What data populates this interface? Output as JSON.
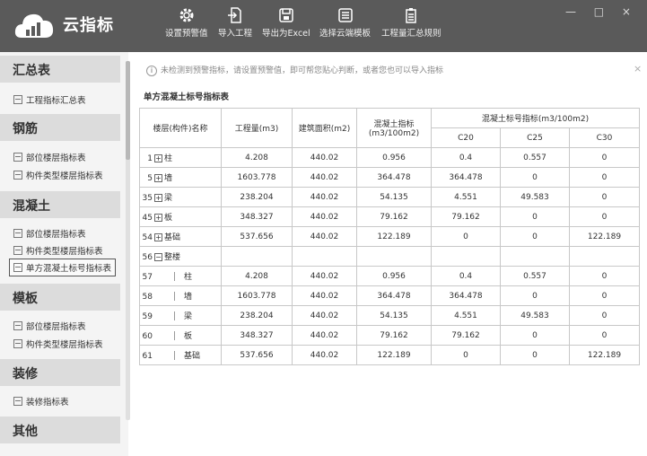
{
  "app": {
    "title": "云指标"
  },
  "window": {
    "controls": "— □ ×"
  },
  "toolbar": [
    {
      "label": "设置预警值",
      "icon": "gear-icon"
    },
    {
      "label": "导入工程",
      "icon": "import-icon"
    },
    {
      "label": "导出为Excel",
      "icon": "export-excel-icon"
    },
    {
      "label": "选择云端模板",
      "icon": "template-icon"
    },
    {
      "label": "工程量汇总规则",
      "icon": "rules-icon"
    }
  ],
  "sidebar": {
    "sections": [
      {
        "title": "汇总表",
        "items": [
          "工程指标汇总表"
        ]
      },
      {
        "title": "钢筋",
        "items": [
          "部位楼层指标表",
          "构件类型楼层指标表"
        ]
      },
      {
        "title": "混凝土",
        "items": [
          "部位楼层指标表",
          "构件类型楼层指标表",
          "单方混凝土标号指标表"
        ]
      },
      {
        "title": "模板",
        "items": [
          "部位楼层指标表",
          "构件类型楼层指标表"
        ]
      },
      {
        "title": "装修",
        "items": [
          "装修指标表"
        ]
      },
      {
        "title": "其他",
        "items": []
      }
    ],
    "active_item": "单方混凝土标号指标表"
  },
  "notice": {
    "text": "未检测到预警指标，请设置预警值，即可帮您贴心判断，或者您也可以导入指标"
  },
  "table": {
    "title": "单方混凝土标号指标表",
    "headers": {
      "name": "楼层(构件)名称",
      "quantity": "工程量(m3)",
      "area": "建筑面积(m2)",
      "concrete_index": "混凝土指标\n(m3/100m2)",
      "grade_group": "混凝土标号指标(m3/100m2)",
      "c20": "C20",
      "c25": "C25",
      "c30": "C30"
    },
    "rows": [
      {
        "num": "1",
        "toggle": "+",
        "name": "柱",
        "qty": "4.208",
        "area": "440.02",
        "index": "0.956",
        "c20": "0.4",
        "c25": "0.557",
        "c30": "0"
      },
      {
        "num": "5",
        "toggle": "+",
        "name": "墙",
        "qty": "1603.778",
        "area": "440.02",
        "index": "364.478",
        "c20": "364.478",
        "c25": "0",
        "c30": "0"
      },
      {
        "num": "35",
        "toggle": "+",
        "name": "梁",
        "qty": "238.204",
        "area": "440.02",
        "index": "54.135",
        "c20": "4.551",
        "c25": "49.583",
        "c30": "0"
      },
      {
        "num": "45",
        "toggle": "+",
        "name": "板",
        "qty": "348.327",
        "area": "440.02",
        "index": "79.162",
        "c20": "79.162",
        "c25": "0",
        "c30": "0"
      },
      {
        "num": "54",
        "toggle": "+",
        "name": "基础",
        "qty": "537.656",
        "area": "440.02",
        "index": "122.189",
        "c20": "0",
        "c25": "0",
        "c30": "122.189"
      },
      {
        "num": "56",
        "toggle": "−",
        "name": "整楼",
        "qty": "",
        "area": "",
        "index": "",
        "c20": "",
        "c25": "",
        "c30": ""
      },
      {
        "num": "57",
        "toggle": "",
        "name": "柱",
        "qty": "4.208",
        "area": "440.02",
        "index": "0.956",
        "c20": "0.4",
        "c25": "0.557",
        "c30": "0"
      },
      {
        "num": "58",
        "toggle": "",
        "name": "墙",
        "qty": "1603.778",
        "area": "440.02",
        "index": "364.478",
        "c20": "364.478",
        "c25": "0",
        "c30": "0"
      },
      {
        "num": "59",
        "toggle": "",
        "name": "梁",
        "qty": "238.204",
        "area": "440.02",
        "index": "54.135",
        "c20": "4.551",
        "c25": "49.583",
        "c30": "0"
      },
      {
        "num": "60",
        "toggle": "",
        "name": "板",
        "qty": "348.327",
        "area": "440.02",
        "index": "79.162",
        "c20": "79.162",
        "c25": "0",
        "c30": "0"
      },
      {
        "num": "61",
        "toggle": "",
        "name": "基础",
        "qty": "537.656",
        "area": "440.02",
        "index": "122.189",
        "c20": "0",
        "c25": "0",
        "c30": "122.189"
      }
    ]
  }
}
